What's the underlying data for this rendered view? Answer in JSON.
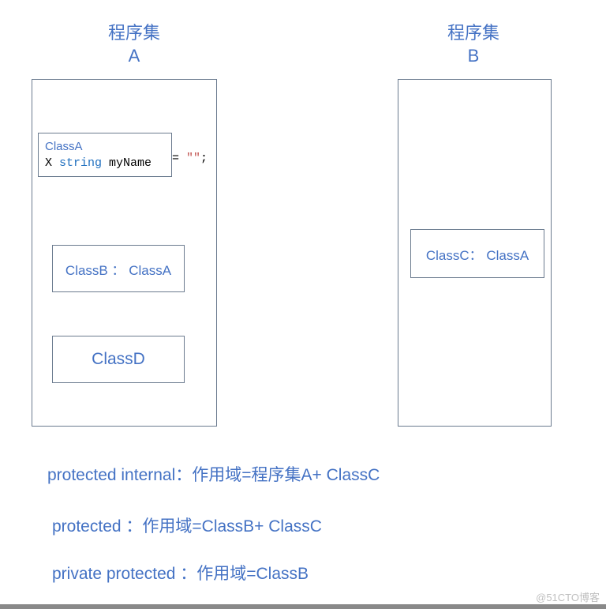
{
  "titles": {
    "assemblyA_line1": "程序集",
    "assemblyA_line2": "A",
    "assemblyB_line1": "程序集",
    "assemblyB_line2": "B"
  },
  "classA": {
    "name": "ClassA",
    "code_x": "X ",
    "code_type": "string",
    "code_var": " myName",
    "code_outside_prefix": " = ",
    "code_outside_quote1": "\"",
    "code_outside_quote2": "\"",
    "code_outside_semi": ";"
  },
  "boxes": {
    "classB": "ClassB ： ClassA",
    "classD": "ClassD",
    "classC": "ClassC： ClassA"
  },
  "notes": {
    "n1": "protected internal：作用域=程序集A+ ClassC",
    "n2": "protected ：作用域=ClassB+ ClassC",
    "n3": "private protected ：作用域=ClassB"
  },
  "watermark": "@51CTO博客"
}
